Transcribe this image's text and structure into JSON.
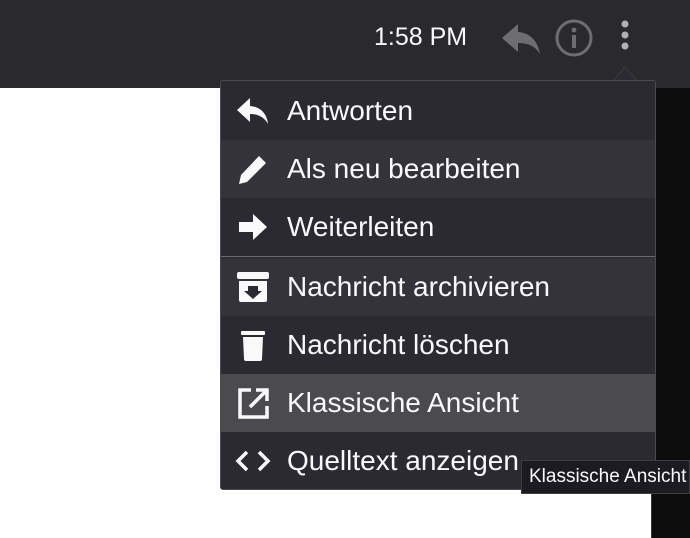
{
  "header": {
    "time": "1:58 PM",
    "icons": {
      "reply": "reply-icon",
      "info": "info-icon",
      "more": "more-vertical-icon"
    }
  },
  "menu": {
    "items": [
      {
        "label": "Antworten",
        "icon": "reply-icon"
      },
      {
        "label": "Als neu bearbeiten",
        "icon": "pencil-icon"
      },
      {
        "label": "Weiterleiten",
        "icon": "forward-arrow-icon"
      },
      {
        "label": "Nachricht archivieren",
        "icon": "archive-icon"
      },
      {
        "label": "Nachricht löschen",
        "icon": "trash-icon"
      },
      {
        "label": "Klassische Ansicht",
        "icon": "open-external-icon"
      },
      {
        "label": "Quelltext anzeigen",
        "icon": "code-icon"
      }
    ]
  },
  "tooltip": {
    "text": "Klassische Ansicht"
  },
  "colors": {
    "topbar": "#2a2a2e",
    "menu_bg": "#2b2a33",
    "highlight": "#4a4a4f",
    "text": "#f9f9fa"
  }
}
